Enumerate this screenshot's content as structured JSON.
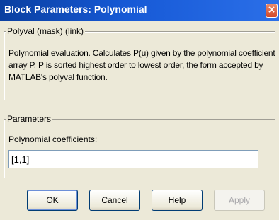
{
  "window": {
    "title": "Block Parameters: Polynomial",
    "close_glyph": "×"
  },
  "description_group": {
    "legend": "Polyval (mask) (link)",
    "text": "Polynomial evaluation.  Calculates P(u) given by the polynomial coefficient array P.  P is sorted highest order to lowest order, the form accepted by MATLAB's polyval function."
  },
  "parameters_group": {
    "legend": "Parameters",
    "coefficients_label": "Polynomial coefficients:",
    "coefficients_value": "[1,1]"
  },
  "buttons": {
    "ok": "OK",
    "cancel": "Cancel",
    "help": "Help",
    "apply": "Apply"
  },
  "colors": {
    "titlebar": "#1659d6",
    "dialog_bg": "#ece9d8",
    "close_button": "#d2482a"
  }
}
